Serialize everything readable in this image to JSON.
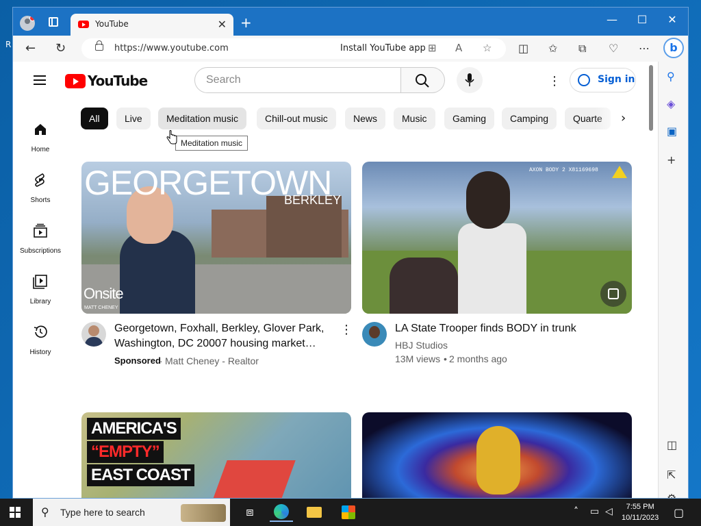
{
  "desktop": {
    "fragment": "R"
  },
  "browser": {
    "tab_title": "YouTube",
    "tab_close": "✕",
    "new_tab": "+",
    "url": "https://www.youtube.com",
    "install_text": "Install YouTube app"
  },
  "youtube": {
    "logo_text": "YouTube",
    "search_placeholder": "Search",
    "sign_in": "Sign in",
    "guide": [
      {
        "label": "Home"
      },
      {
        "label": "Shorts"
      },
      {
        "label": "Subscriptions"
      },
      {
        "label": "Library"
      },
      {
        "label": "History"
      }
    ],
    "chips": [
      "All",
      "Live",
      "Meditation music",
      "Chill-out music",
      "News",
      "Music",
      "Gaming",
      "Camping",
      "Quarte"
    ],
    "tooltip": "Meditation music",
    "videos": [
      {
        "title": "Georgetown, Foxhall, Berkley, Glover Park, Washington, DC 20007 housing market…",
        "sponsored": "Sponsored",
        "channel": "Matt Cheney - Realtor",
        "thumb_text_top": "GEORGETOWN",
        "thumb_text_sub": "BERKLEY",
        "thumb_text_badge": "Onsite",
        "thumb_text_name": "MATT CHENEY"
      },
      {
        "title": "LA State Trooper finds BODY in trunk",
        "channel": "HBJ Studios",
        "views": "13M views",
        "age": "2 months ago",
        "thumb_text_overlay": "AXON BODY 2 X81169698"
      },
      {
        "thumb_text_1": "AMERICA'S",
        "thumb_text_2": "“EMPTY”",
        "thumb_text_3": "EAST COAST"
      },
      {}
    ]
  },
  "taskbar": {
    "search_text": "Type here to search",
    "time": "7:55 PM",
    "date": "10/11/2023"
  },
  "colors": {
    "yt_red": "#ff0000",
    "edge_blue": "#1c72c4",
    "link_blue": "#065fd4"
  }
}
